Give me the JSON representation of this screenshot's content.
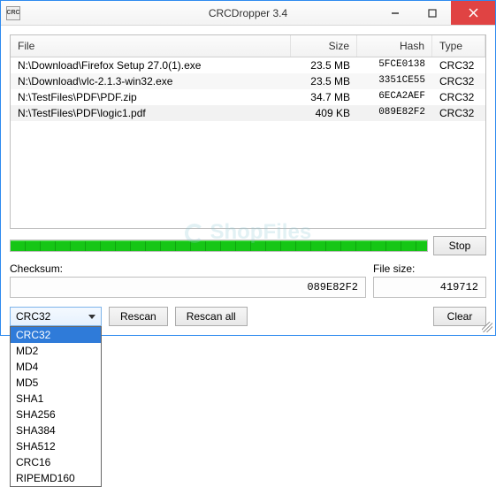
{
  "titlebar": {
    "app_icon_text": "CRC",
    "title": "CRCDropper 3.4"
  },
  "list": {
    "headers": {
      "file": "File",
      "size": "Size",
      "hash": "Hash",
      "type": "Type"
    },
    "rows": [
      {
        "file": "N:\\Download\\Firefox Setup 27.0(1).exe",
        "size": "23.5 MB",
        "hash": "5FCE0138",
        "type": "CRC32"
      },
      {
        "file": "N:\\Download\\vlc-2.1.3-win32.exe",
        "size": "23.5 MB",
        "hash": "3351CE55",
        "type": "CRC32"
      },
      {
        "file": "N:\\TestFiles\\PDF\\PDF.zip",
        "size": "34.7 MB",
        "hash": "6ECA2AEF",
        "type": "CRC32"
      },
      {
        "file": "N:\\TestFiles\\PDF\\logic1.pdf",
        "size": "409 KB",
        "hash": "089E82F2",
        "type": "CRC32"
      }
    ],
    "selected_index": 3
  },
  "buttons": {
    "stop": "Stop",
    "rescan": "Rescan",
    "rescan_all": "Rescan all",
    "clear": "Clear"
  },
  "labels": {
    "checksum": "Checksum:",
    "filesize": "File size:"
  },
  "fields": {
    "checksum": "089E82F2",
    "filesize": "419712"
  },
  "algo": {
    "selected": "CRC32",
    "options": [
      "CRC32",
      "MD2",
      "MD4",
      "MD5",
      "SHA1",
      "SHA256",
      "SHA384",
      "SHA512",
      "CRC16",
      "RIPEMD160"
    ]
  }
}
